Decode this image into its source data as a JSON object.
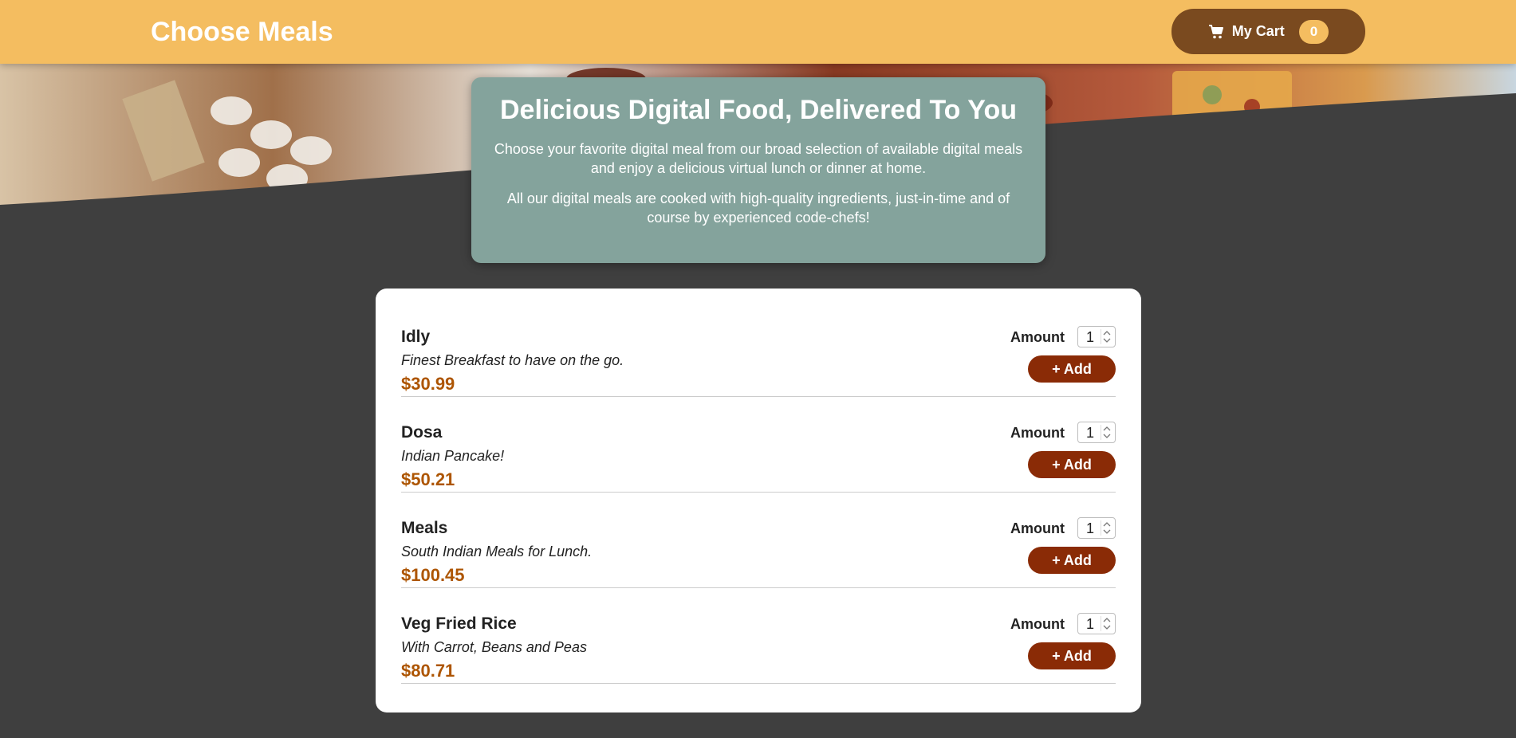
{
  "header": {
    "title": "Choose Meals",
    "cart_label": "My Cart",
    "cart_count": "0"
  },
  "summary": {
    "heading": "Delicious Digital Food, Delivered To You",
    "paragraph1": "Choose your favorite digital meal from our broad selection of available digital meals and enjoy a delicious virtual lunch or dinner at home.",
    "paragraph2": "All our digital meals are cooked with high-quality ingredients, just-in-time and of course by experienced code-chefs!"
  },
  "meals": [
    {
      "name": "Idly",
      "description": "Finest Breakfast to have on the go.",
      "price": "$30.99",
      "amount_label": "Amount",
      "amount": "1",
      "add_label": "+ Add"
    },
    {
      "name": "Dosa",
      "description": "Indian Pancake!",
      "price": "$50.21",
      "amount_label": "Amount",
      "amount": "1",
      "add_label": "+ Add"
    },
    {
      "name": "Meals",
      "description": "South Indian Meals for Lunch.",
      "price": "$100.45",
      "amount_label": "Amount",
      "amount": "1",
      "add_label": "+ Add"
    },
    {
      "name": "Veg Fried Rice",
      "description": "With Carrot, Beans and Peas",
      "price": "$80.71",
      "amount_label": "Amount",
      "amount": "1",
      "add_label": "+ Add"
    }
  ],
  "icons": {
    "cart": "shopping-cart-icon",
    "spinner": "spinner-arrows-icon"
  },
  "colors": {
    "header_bg": "#f4bd60",
    "cart_button_bg": "#7a4a1f",
    "summary_bg": "#84a39c",
    "price": "#ad5502",
    "add_button_bg": "#8a2b06",
    "page_bg": "#3f3f3f"
  }
}
